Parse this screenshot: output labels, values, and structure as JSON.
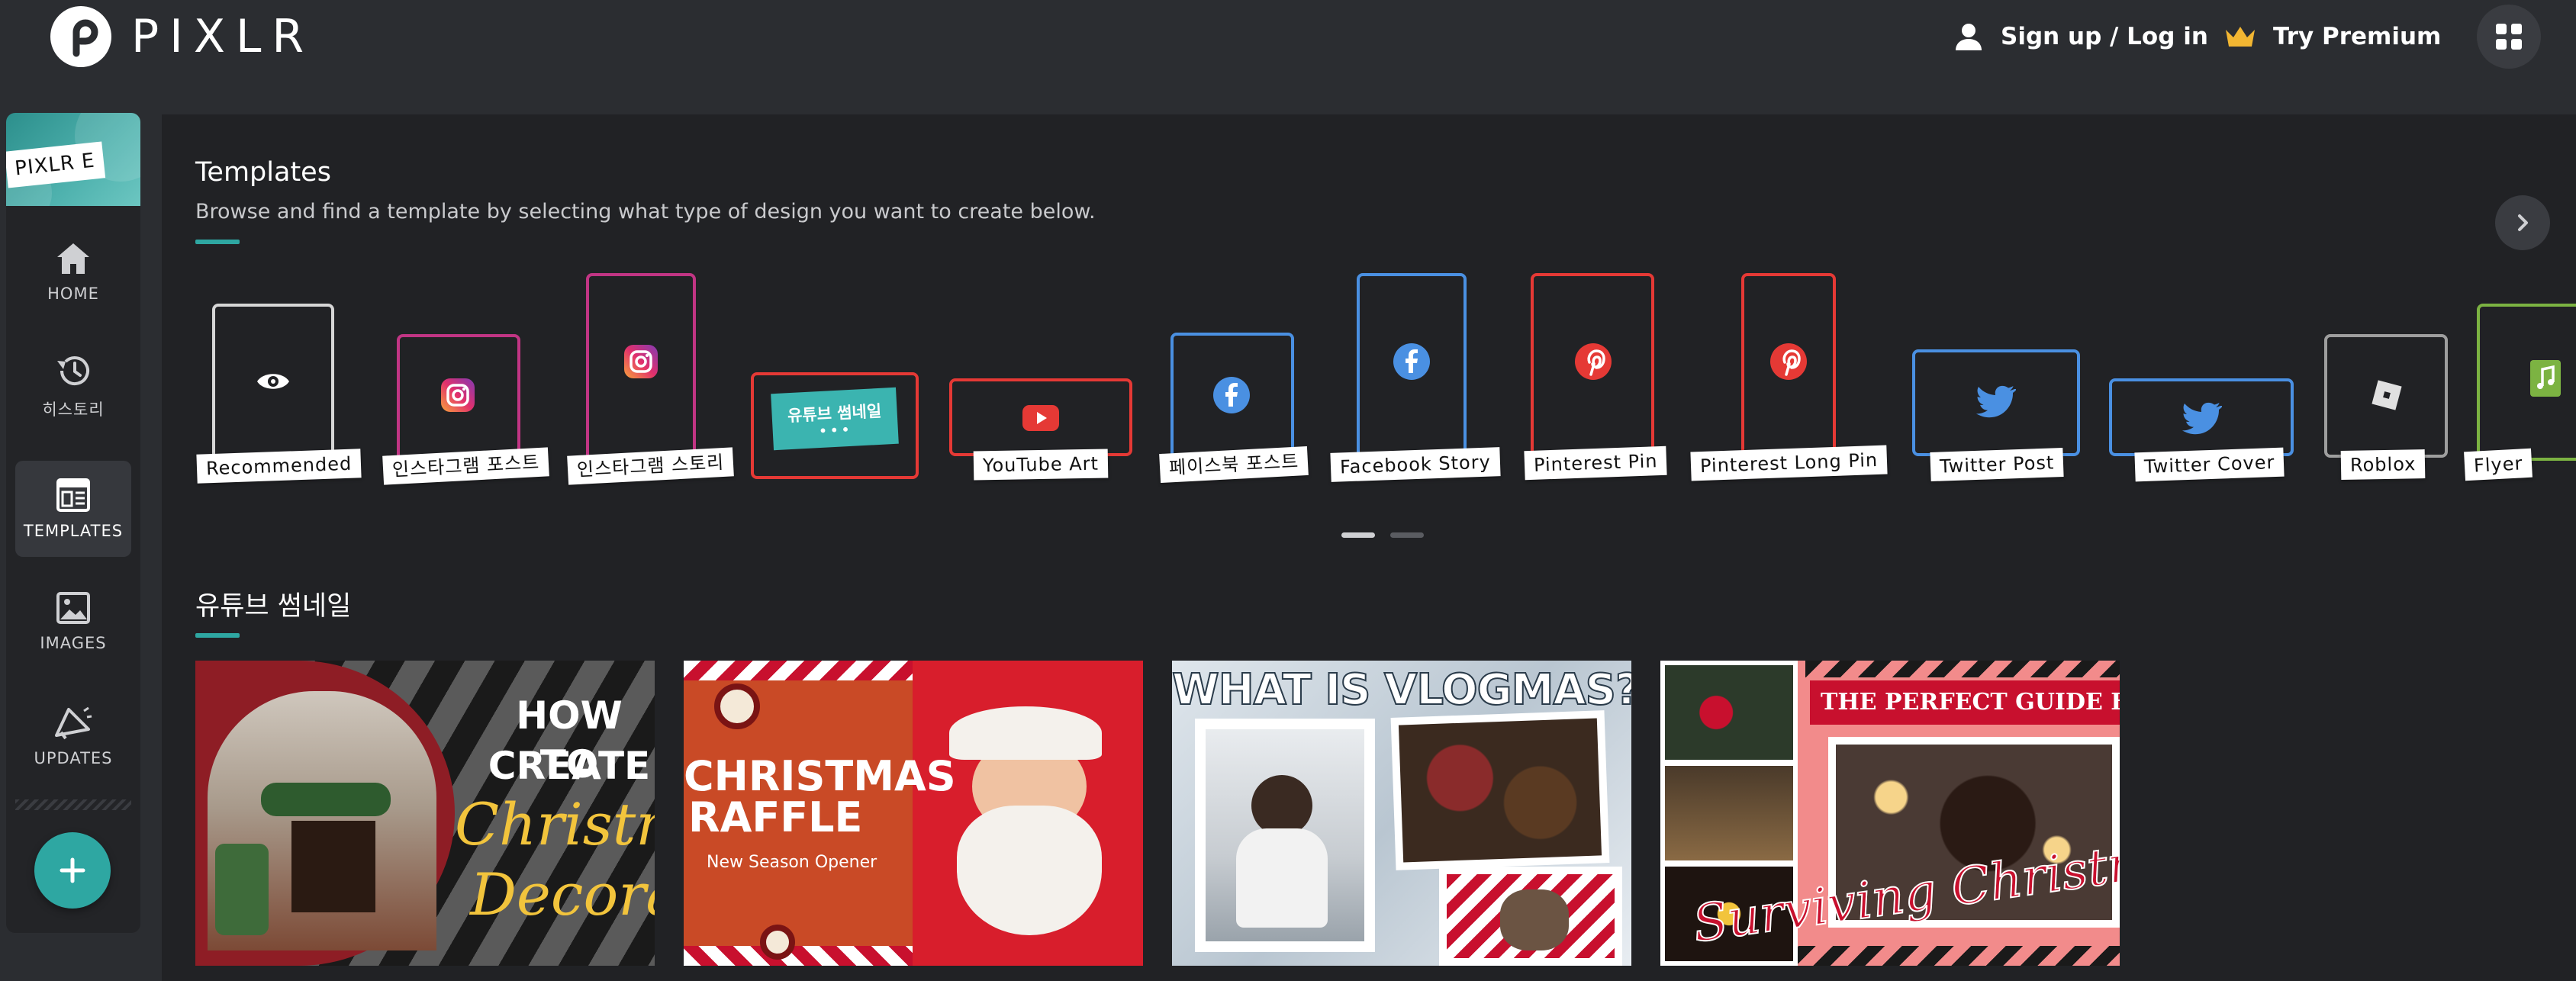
{
  "header": {
    "logo_text": "PIXLR",
    "signup_label": "Sign up / Log in",
    "premium_label": "Try Premium"
  },
  "sidebar": {
    "editor_label": "PIXLR E",
    "items": [
      {
        "label": "HOME"
      },
      {
        "label": "히스토리"
      },
      {
        "label": "TEMPLATES"
      },
      {
        "label": "IMAGES"
      },
      {
        "label": "UPDATES"
      }
    ],
    "active": "TEMPLATES"
  },
  "templates_section": {
    "title": "Templates",
    "subtitle": "Browse and find a template by selecting what type of design you want to create below.",
    "items": [
      {
        "label": "Recommended",
        "icon": "eye-icon",
        "color": "#d6d6d6"
      },
      {
        "label": "인스타그램 포스트",
        "icon": "instagram-icon",
        "color": "#c13584"
      },
      {
        "label": "인스타그램 스토리",
        "icon": "instagram-icon",
        "color": "#c13584"
      },
      {
        "label": "유튜브 썸네일",
        "icon": "thumbnail-card",
        "color": "#e53935",
        "badge": "유튜브 썸네일"
      },
      {
        "label": "YouTube Art",
        "icon": "youtube-icon",
        "color": "#e53935"
      },
      {
        "label": "페이스북 포스트",
        "icon": "facebook-icon",
        "color": "#4a90e2"
      },
      {
        "label": "Facebook Story",
        "icon": "facebook-icon",
        "color": "#4a90e2"
      },
      {
        "label": "Pinterest Pin",
        "icon": "pinterest-icon",
        "color": "#e53935"
      },
      {
        "label": "Pinterest Long Pin",
        "icon": "pinterest-icon",
        "color": "#e53935"
      },
      {
        "label": "Twitter Post",
        "icon": "twitter-icon",
        "color": "#4a90e2"
      },
      {
        "label": "Twitter Cover",
        "icon": "twitter-icon",
        "color": "#4a90e2"
      },
      {
        "label": "Roblox",
        "icon": "roblox-icon",
        "color": "#9e9e9e"
      },
      {
        "label": "Flyer",
        "icon": "flyer-icon",
        "color": "#7cb342"
      }
    ]
  },
  "youtube_section": {
    "title": "유튜브 썸네일",
    "thumbnails": [
      {
        "lines": [
          "HOW TO",
          "CREATE",
          "Christmas",
          "Decoration"
        ]
      },
      {
        "lines": [
          "CHRISTMAS",
          "RAFFLE",
          "New Season Opener"
        ]
      },
      {
        "lines": [
          "WHAT IS VLOGMAS?"
        ]
      },
      {
        "lines": [
          "THE PERFECT GUIDE FOR",
          "Surviving Christmas"
        ]
      }
    ]
  },
  "colors": {
    "accent": "#2ea7a2",
    "background": "#2b2d31",
    "panel": "#212225"
  }
}
